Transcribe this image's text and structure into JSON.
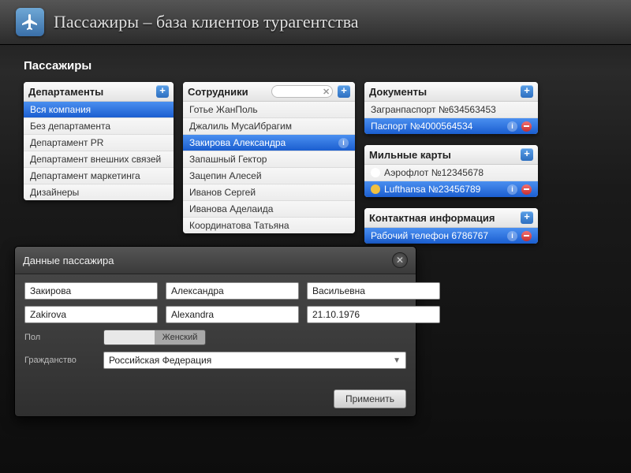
{
  "header": {
    "title": "Пассажиры – база клиентов турагентства"
  },
  "section_title": "Пассажиры",
  "departments": {
    "title": "Департаменты",
    "items": [
      {
        "label": "Вся компания",
        "selected": true
      },
      {
        "label": "Без департамента",
        "selected": false
      },
      {
        "label": "Департамент PR",
        "selected": false
      },
      {
        "label": "Департамент внешних связей",
        "selected": false
      },
      {
        "label": "Департамент маркетинга",
        "selected": false
      },
      {
        "label": "Дизайнеры",
        "selected": false
      }
    ]
  },
  "employees": {
    "title": "Сотрудники",
    "search_placeholder": "",
    "items": [
      {
        "label": "Готье ЖанПоль",
        "selected": false
      },
      {
        "label": "Джалиль МусаИбрагим",
        "selected": false
      },
      {
        "label": "Закирова Александра",
        "selected": true
      },
      {
        "label": "Запашный Гектор",
        "selected": false
      },
      {
        "label": "Зацепин Алесей",
        "selected": false
      },
      {
        "label": "Иванов Сергей",
        "selected": false
      },
      {
        "label": "Иванова Аделаида",
        "selected": false
      },
      {
        "label": "Координатова Татьяна",
        "selected": false
      }
    ]
  },
  "documents": {
    "title": "Документы",
    "items": [
      {
        "label": "Загранпаспорт №634563453",
        "selected": false
      },
      {
        "label": "Паспорт №4000564534",
        "selected": true
      }
    ]
  },
  "miles": {
    "title": "Мильные карты",
    "items": [
      {
        "label": "Аэрофлот №12345678",
        "selected": false
      },
      {
        "label": "Lufthansa №23456789",
        "selected": true
      }
    ]
  },
  "contacts": {
    "title": "Контактная информация",
    "items": [
      {
        "label": "Рабочий телефон 6786767",
        "selected": true
      }
    ]
  },
  "modal": {
    "title": "Данные пассажира",
    "surname_ru": "Закирова",
    "name_ru": "Александра",
    "patronymic_ru": "Васильевна",
    "surname_en": "Zakirova",
    "name_en": "Alexandra",
    "dob": "21.10.1976",
    "gender_label": "Пол",
    "gender_value": "Женский",
    "citizenship_label": "Гражданство",
    "citizenship_value": "Российская Федерация",
    "apply": "Применить"
  }
}
